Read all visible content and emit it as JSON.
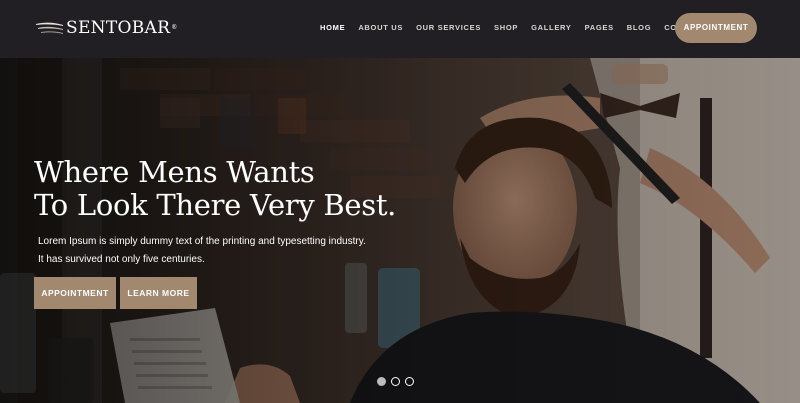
{
  "brand": {
    "name": "SENTOBAR"
  },
  "nav": {
    "items": [
      {
        "label": "HOME",
        "active": true
      },
      {
        "label": "ABOUT US"
      },
      {
        "label": "OUR SERVICES"
      },
      {
        "label": "SHOP"
      },
      {
        "label": "GALLERY"
      },
      {
        "label": "PAGES"
      },
      {
        "label": "BLOG"
      },
      {
        "label": "CONTACT"
      }
    ],
    "cta_label": "APPOINTMENT"
  },
  "hero": {
    "title_lines": [
      "Where Mens Wants",
      "To Look There Very Best."
    ],
    "text_lines": [
      "Lorem Ipsum is simply dummy text of the printing and typesetting industry.",
      "It has survived not only five centuries."
    ],
    "buttons": {
      "appointment": "APPOINTMENT",
      "learn_more": "LEARN MORE"
    },
    "slides": {
      "count": 3,
      "active_index": 0
    }
  },
  "colors": {
    "navbar_bg": "#221f24",
    "accent": "#a2886f",
    "text_light": "#ffffff"
  }
}
